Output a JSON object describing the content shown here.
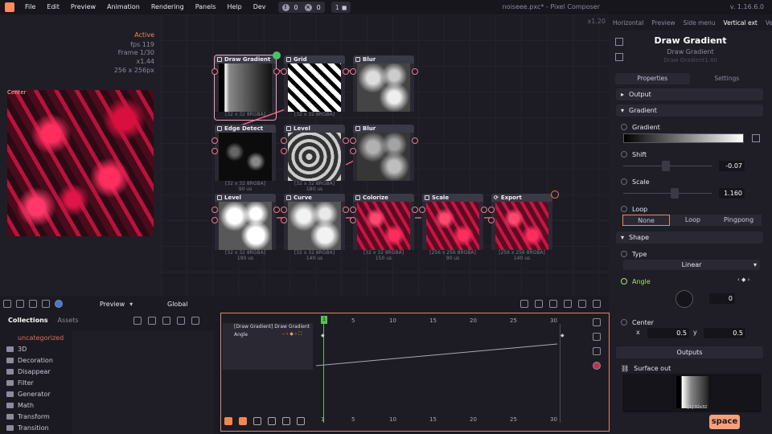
{
  "menu": {
    "items": [
      "File",
      "Edit",
      "Preview",
      "Animation",
      "Rendering",
      "Panels",
      "Help",
      "Dev"
    ],
    "warnings": "0",
    "errors": "0",
    "tasks": "1",
    "filename": "noiseee.pxc* - Pixel Composer",
    "version": "v. 1.16.6.0"
  },
  "preview": {
    "active": "Active",
    "fps": "fps 119",
    "frame": "Frame 1/30",
    "zoom": "x1.44",
    "size": "256 x 256px",
    "center": "Center",
    "mode": "Preview"
  },
  "graph": {
    "zoom": "x1.20",
    "global": "Global",
    "nodes": [
      {
        "title": "Draw Gradient",
        "foot": "[32 x 32 8RGBA]",
        "time": ""
      },
      {
        "title": "Grid",
        "foot": "[32 x 32 8RGBA]",
        "time": ""
      },
      {
        "title": "Blur",
        "foot": "",
        "time": ""
      },
      {
        "title": "Edge Detect",
        "foot": "[32 x 32 8RGBA]",
        "time": "90 us"
      },
      {
        "title": "Level",
        "foot": "[32 x 32 8RGBA]",
        "time": "180 us"
      },
      {
        "title": "Blur",
        "foot": "",
        "time": ""
      },
      {
        "title": "Level",
        "foot": "[32 x 32 8RGBA]",
        "time": "190 us"
      },
      {
        "title": "Curve",
        "foot": "[32 x 32 8RGBA]",
        "time": "140 us"
      },
      {
        "title": "Colorize",
        "foot": "[32 x 32 8RGBA]",
        "time": "150 us"
      },
      {
        "title": "Scale",
        "foot": "[256 x 256 8RGBA]",
        "time": "90 us"
      },
      {
        "title": "Export",
        "foot": "[256 x 256 8RGBA]",
        "time": "140 us"
      }
    ]
  },
  "inspector": {
    "tabs": [
      "Horizontal",
      "Preview",
      "Side menu",
      "Vertical ext",
      "Ve"
    ],
    "title": "Draw Gradient",
    "subtitle": "Draw Gradient",
    "subtitle2": "Draw Gradient1.40",
    "ptabs": [
      "Properties",
      "Settings"
    ],
    "sections": {
      "output": "Output",
      "gradient": "Gradient",
      "shape": "Shape",
      "outputs": "Outputs"
    },
    "props": {
      "gradient": "Gradient",
      "shift": "Shift",
      "shift_val": "-0.07",
      "scale": "Scale",
      "scale_val": "1.160",
      "loop": "Loop",
      "loop_opts": [
        "None",
        "Loop",
        "Pingpong"
      ],
      "type": "Type",
      "type_val": "Linear",
      "angle": "Angle",
      "angle_val": "0",
      "center": "Center",
      "cx_label": "x",
      "cx": "0.5",
      "cy_label": "y",
      "cy": "0.5",
      "surface_out": "Surface out",
      "surface_size": "[1] 32x32"
    },
    "space": "space"
  },
  "collections": {
    "tabs": [
      "Collections",
      "Assets"
    ],
    "items": [
      "uncategorized",
      "3D",
      "Decoration",
      "Disappear",
      "Filter",
      "Generator",
      "Math",
      "Transform",
      "Transition"
    ]
  },
  "timeline": {
    "track": "[Draw Gradient] Draw Gradient",
    "param": "Angle",
    "frame": "1",
    "ticks": [
      "5",
      "10",
      "15",
      "20",
      "25",
      "30"
    ],
    "bticks": [
      "1",
      "5",
      "10",
      "15",
      "20",
      "25",
      "30"
    ]
  }
}
